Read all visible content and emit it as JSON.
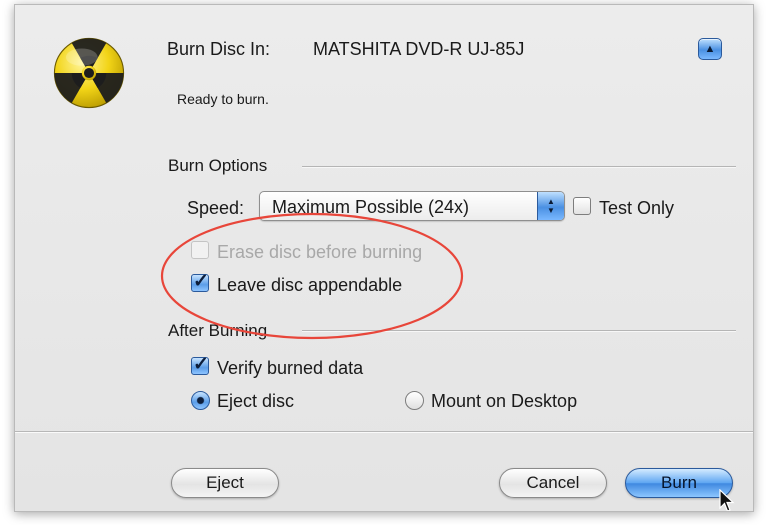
{
  "header": {
    "burn_in_label": "Burn Disc In:",
    "device": "MATSHITA DVD-R UJ-85J",
    "status": "Ready to burn.",
    "collapse_glyph": "▲"
  },
  "burn_options": {
    "title": "Burn Options",
    "speed_label": "Speed:",
    "speed_value": "Maximum Possible (24x)",
    "test_only": {
      "label": "Test Only",
      "checked": false
    },
    "erase_disc": {
      "label": "Erase disc before burning",
      "checked": false,
      "enabled": false
    },
    "leave_appendable": {
      "label": "Leave disc appendable",
      "checked": true
    }
  },
  "after_burning": {
    "title": "After Burning",
    "verify": {
      "label": "Verify burned data",
      "checked": true
    },
    "eject_disc": {
      "label": "Eject disc",
      "selected": true
    },
    "mount_desktop": {
      "label": "Mount on Desktop",
      "selected": false
    }
  },
  "buttons": {
    "eject": "Eject",
    "cancel": "Cancel",
    "burn": "Burn"
  },
  "icons": {
    "app": "radioactive-icon",
    "cursor": "pointer-cursor-icon"
  },
  "colors": {
    "annotation": "#e8463a",
    "accent": "#4a90e2",
    "icon_yellow": "#f2d417"
  }
}
